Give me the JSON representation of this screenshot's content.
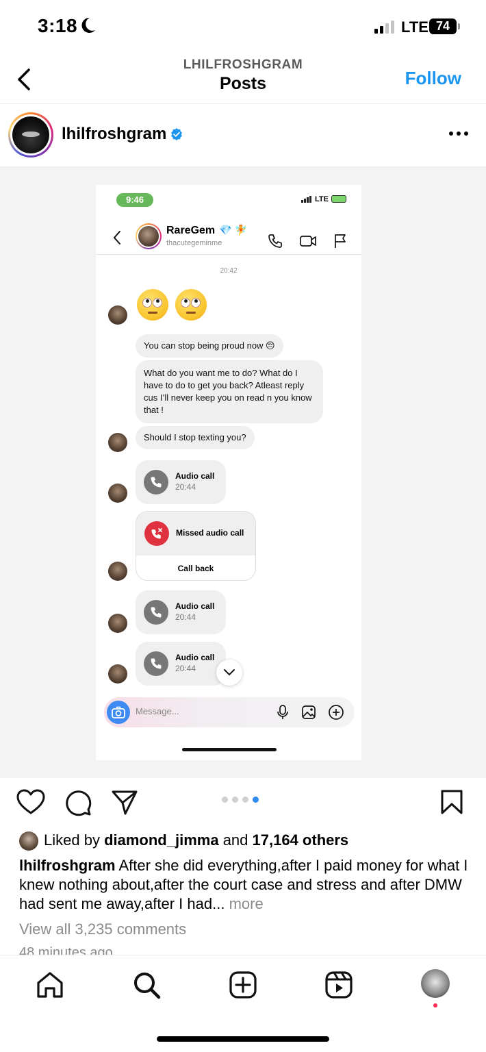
{
  "status_bar": {
    "time": "3:18",
    "network": "LTE",
    "battery": "74"
  },
  "nav": {
    "username": "LHILFROSHGRAM",
    "title": "Posts",
    "follow_label": "Follow"
  },
  "post": {
    "author": "lhilfroshgram",
    "verified": true
  },
  "screenshot": {
    "status_time": "9:46",
    "status_network": "LTE",
    "contact_name": "RareGem",
    "contact_emoji": "💎 🧚",
    "contact_handle": "thacutegeminme",
    "timestamp": "20:42",
    "messages": [
      "You can stop being proud now 😔",
      "What do you want me to do? What do I have to do to get you back? Atleast reply cus I’ll never keep you on read n you know that !",
      "Should I stop texting you?"
    ],
    "calls": [
      {
        "title": "Audio call",
        "time": "20:44"
      },
      {
        "title": "Audio call",
        "time": "20:44"
      },
      {
        "title": "Audio call",
        "time": "20:44"
      }
    ],
    "missed_call": "Missed audio call",
    "call_back": "Call back",
    "message_placeholder": "Message..."
  },
  "carousel": {
    "count": 4,
    "active_index": 3
  },
  "engagement": {
    "liked_by_prefix": "Liked by",
    "liked_by_user": "diamond_jimma",
    "and_text": "and",
    "others": "17,164 others",
    "caption_user": "lhilfroshgram",
    "caption_text": "After she did everything,after I paid money for what I knew nothing about,after the court case and stress and after DMW had sent me away,after I had...",
    "more": "more",
    "view_comments": "View all 3,235 comments",
    "time_ago": "48 minutes ago"
  },
  "icons": {
    "accent": "#1b95f0",
    "missed_red": "#e0323e",
    "pager_active": "#2f8cf0"
  }
}
